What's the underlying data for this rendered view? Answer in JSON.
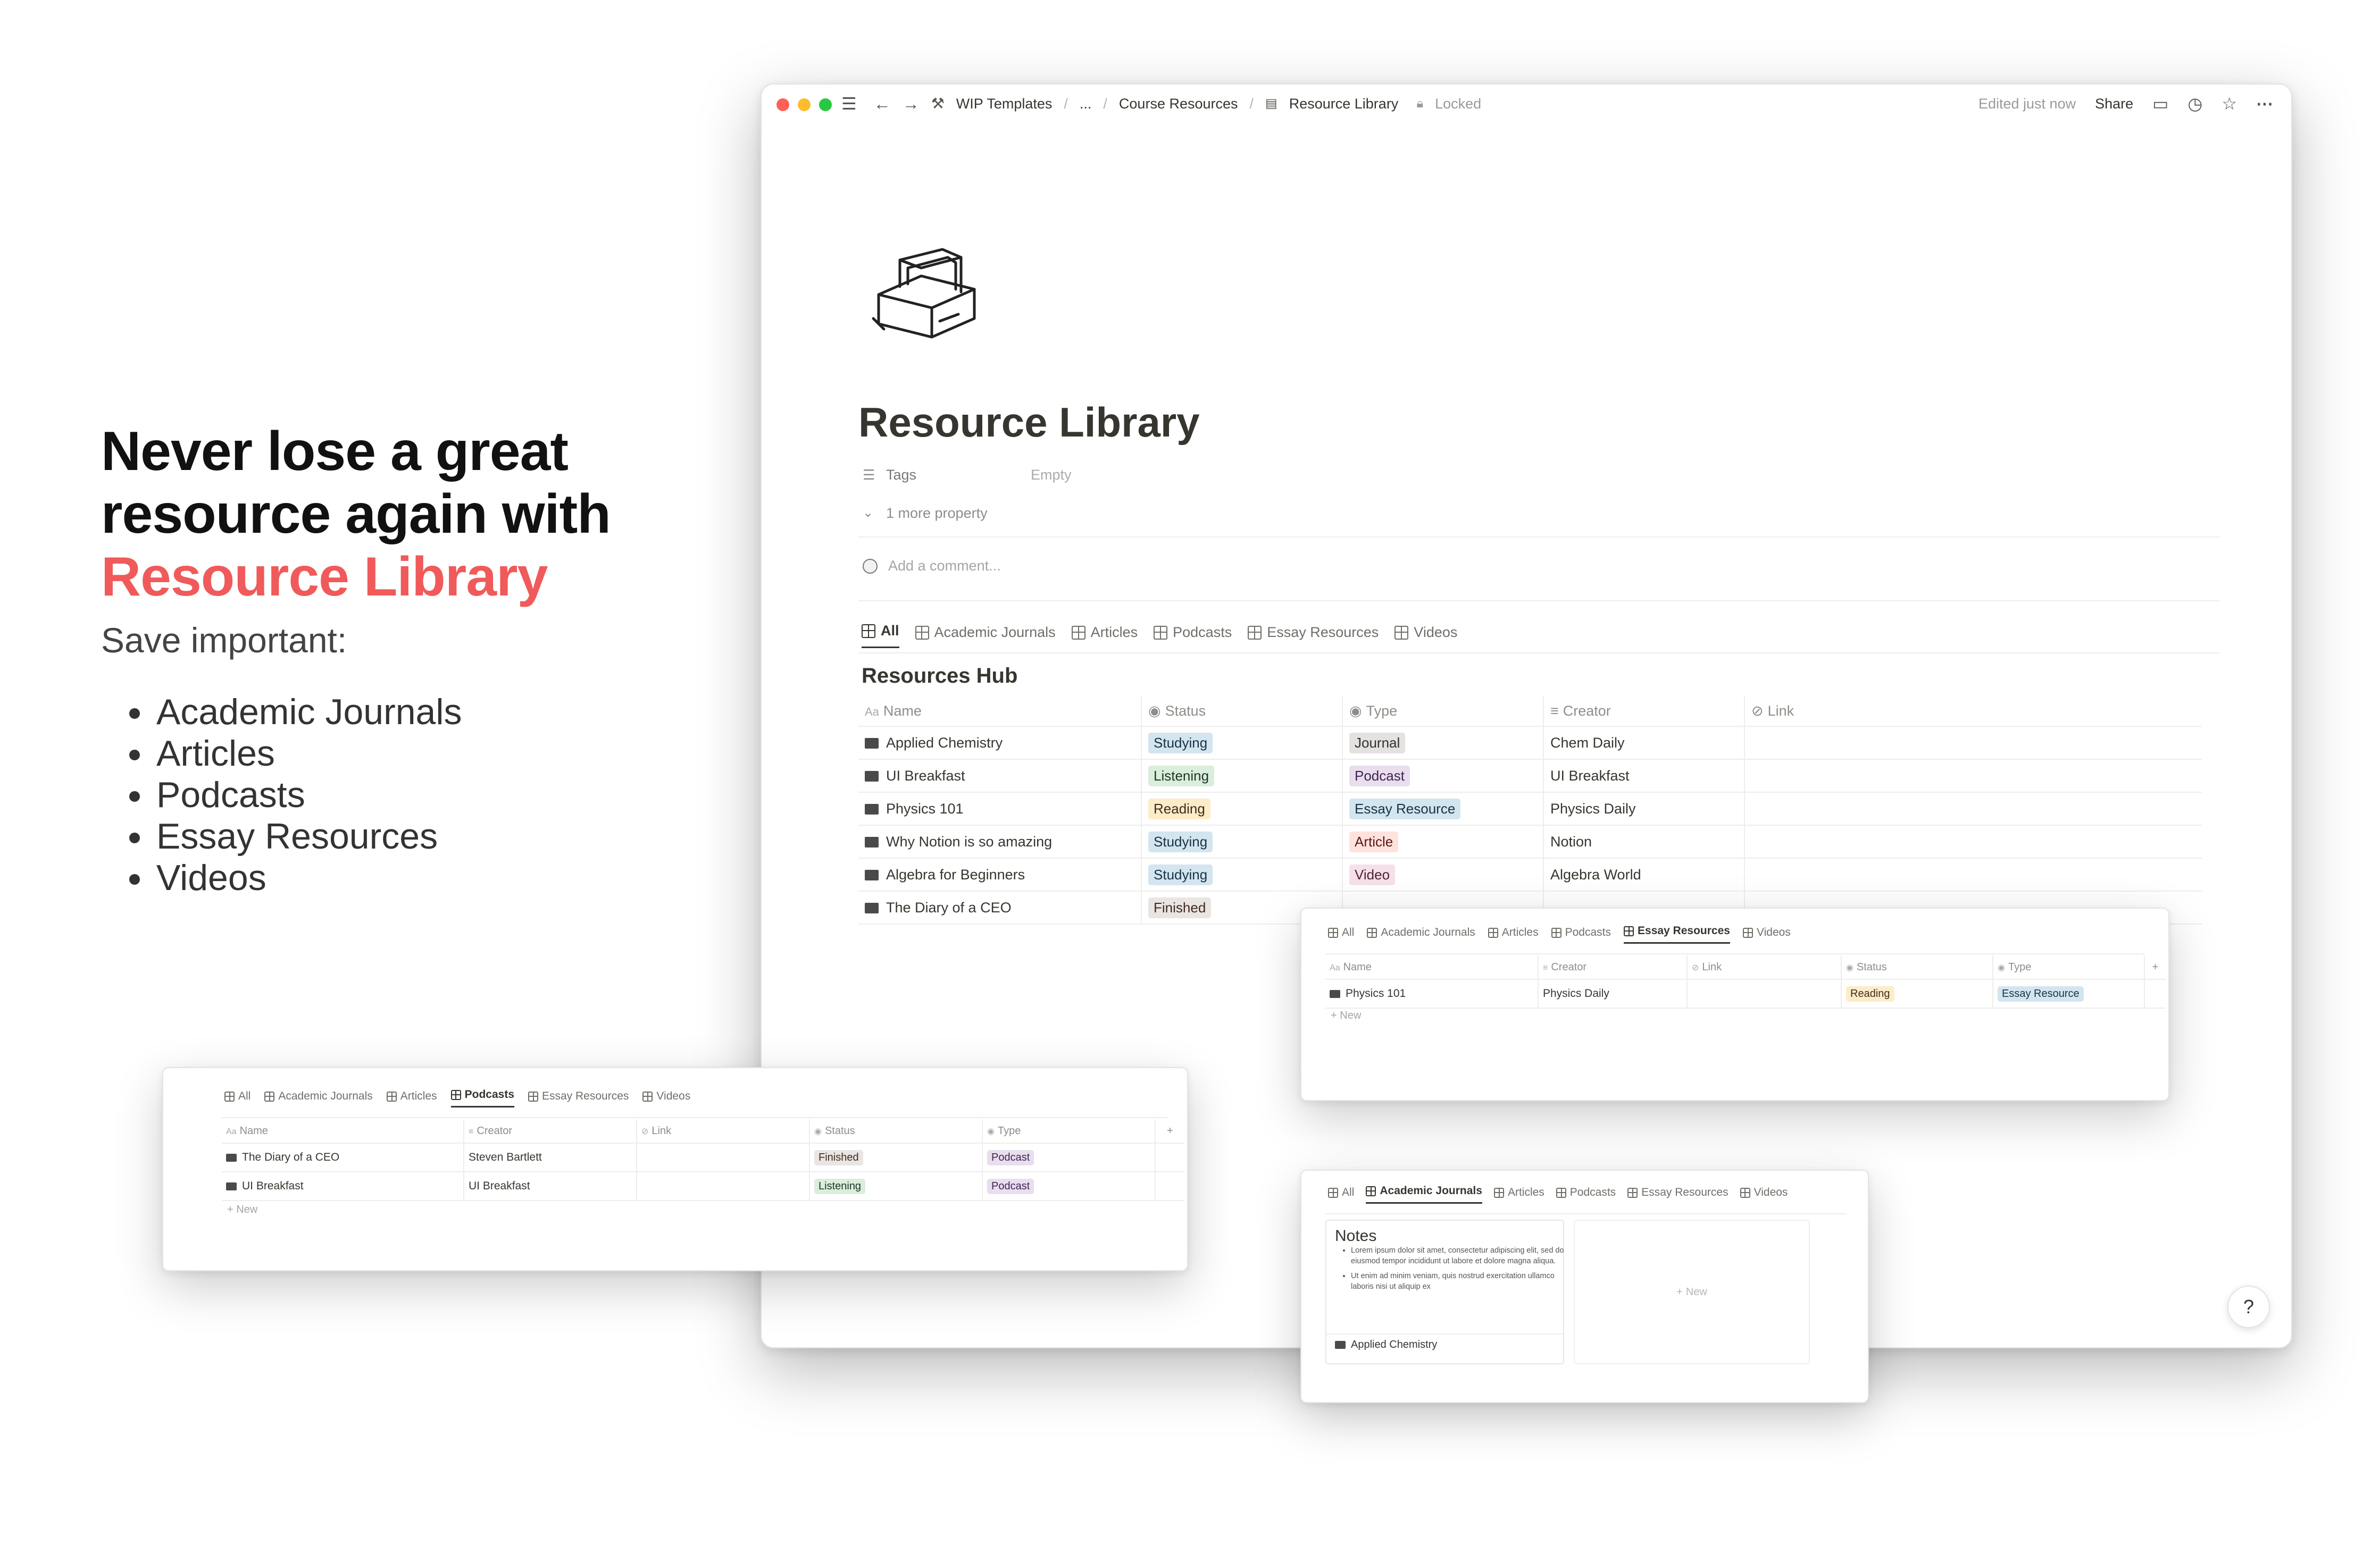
{
  "hero": {
    "line1": "Never lose a great",
    "line2": "resource again with",
    "accent": "Resource Library",
    "sub": "Save important:",
    "items": [
      "Academic Journals",
      "Articles",
      "Podcasts",
      "Essay Resources",
      "Videos"
    ]
  },
  "colors": {
    "accent": "#f05a5a",
    "studying_bg": "#d3e5ef",
    "studying_fg": "#183347",
    "listening_bg": "#dbeddb",
    "listening_fg": "#1c3829",
    "reading_bg": "#fdecc8",
    "reading_fg": "#402c1b",
    "finished_bg": "#e9e5e3",
    "finished_fg": "#442a1e",
    "journal_bg": "#e3e2e0",
    "podcast_bg": "#e8deee",
    "essay_bg": "#d3e5ef",
    "article_bg": "#ffe2dd",
    "video_bg": "#f5e0e9"
  },
  "window": {
    "breadcrumb": [
      "WIP Templates",
      "...",
      "Course Resources",
      "Resource Library"
    ],
    "locked": "Locked",
    "edited": "Edited just now",
    "share": "Share",
    "title": "Resource Library",
    "prop_tags": "Tags",
    "prop_tags_value": "Empty",
    "more_property": "1 more property",
    "comment_placeholder": "Add a comment...",
    "tabs": [
      "All",
      "Academic Journals",
      "Articles",
      "Podcasts",
      "Essay Resources",
      "Videos"
    ],
    "hub_title": "Resources Hub",
    "columns": [
      "Name",
      "Status",
      "Type",
      "Creator",
      "Link"
    ],
    "rows": [
      {
        "name": "Applied Chemistry",
        "status": "Studying",
        "type": "Journal",
        "creator": "Chem Daily"
      },
      {
        "name": "UI Breakfast",
        "status": "Listening",
        "type": "Podcast",
        "creator": "UI Breakfast"
      },
      {
        "name": "Physics 101",
        "status": "Reading",
        "type": "Essay Resource",
        "creator": "Physics Daily"
      },
      {
        "name": "Why Notion is so amazing",
        "status": "Studying",
        "type": "Article",
        "creator": "Notion"
      },
      {
        "name": "Algebra for Beginners",
        "status": "Studying",
        "type": "Video",
        "creator": "Algebra World"
      },
      {
        "name": "The Diary of a CEO",
        "status": "Finished",
        "type": "",
        "creator": ""
      }
    ],
    "help": "?"
  },
  "essay_card": {
    "tabs": [
      "All",
      "Academic Journals",
      "Articles",
      "Podcasts",
      "Essay Resources",
      "Videos"
    ],
    "columns": [
      "Name",
      "Creator",
      "Link",
      "Status",
      "Type"
    ],
    "rows": [
      {
        "name": "Physics 101",
        "creator": "Physics Daily",
        "link": "",
        "status": "Reading",
        "type": "Essay Resource"
      }
    ],
    "new": "New",
    "add": "+"
  },
  "podcast_card": {
    "tabs": [
      "All",
      "Academic Journals",
      "Articles",
      "Podcasts",
      "Essay Resources",
      "Videos"
    ],
    "columns": [
      "Name",
      "Creator",
      "Link",
      "Status",
      "Type"
    ],
    "rows": [
      {
        "name": "The Diary of a CEO",
        "creator": "Steven Bartlett",
        "link": "",
        "status": "Finished",
        "type": "Podcast"
      },
      {
        "name": "UI Breakfast",
        "creator": "UI Breakfast",
        "link": "",
        "status": "Listening",
        "type": "Podcast"
      }
    ],
    "new": "New",
    "add": "+"
  },
  "journal_card": {
    "tabs": [
      "All",
      "Academic Journals",
      "Articles",
      "Podcasts",
      "Essay Resources",
      "Videos"
    ],
    "notes_title": "Notes",
    "bullets": [
      "Lorem ipsum dolor sit amet, consectetur adipiscing elit, sed do eiusmod tempor incididunt ut labore et dolore magna aliqua.",
      "Ut enim ad minim veniam, quis nostrud exercitation ullamco laboris nisi ut aliquip ex"
    ],
    "item_name": "Applied Chemistry",
    "new": "New"
  }
}
